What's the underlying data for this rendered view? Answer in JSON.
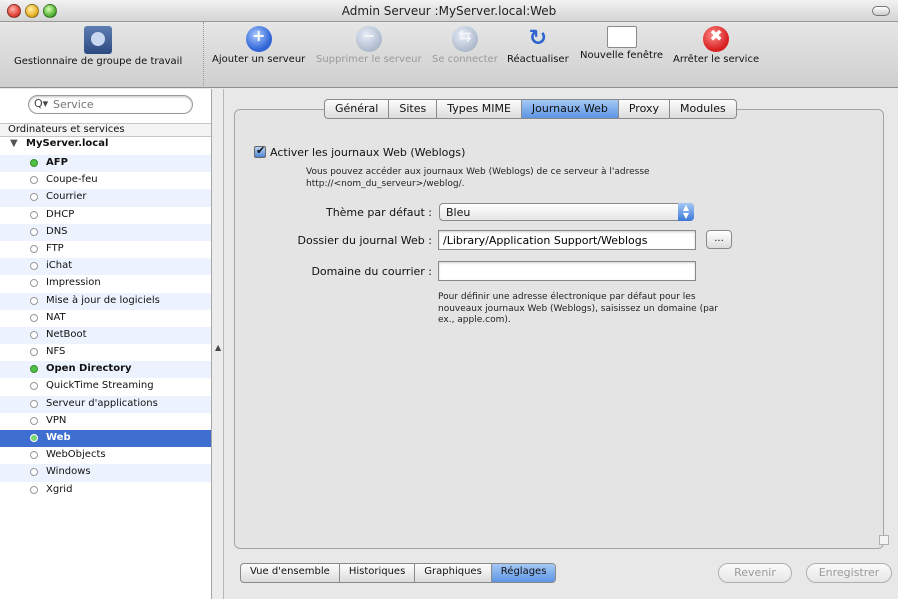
{
  "window": {
    "title": "Admin Serveur :MyServer.local:Web"
  },
  "toolbar": {
    "left_label": "Gestionnaire de groupe de travail",
    "items": [
      {
        "label": "Ajouter un serveur",
        "icon": "add-server-icon",
        "enabled": true
      },
      {
        "label": "Supprimer le serveur",
        "icon": "remove-server-icon",
        "enabled": false
      },
      {
        "label": "Se connecter",
        "icon": "connect-icon",
        "enabled": false
      },
      {
        "label": "Réactualiser",
        "icon": "refresh-icon",
        "enabled": true
      },
      {
        "label": "Nouvelle fenêtre",
        "icon": "new-window-icon",
        "enabled": true
      },
      {
        "label": "Arrêter le service",
        "icon": "stop-service-icon",
        "enabled": true
      }
    ],
    "stop_glyph": "✖",
    "refresh_glyph": "↻"
  },
  "sidebar": {
    "search_placeholder": "Service",
    "search_glyph": "Q▾",
    "header": "Ordinateurs et services",
    "server": "MyServer.local",
    "services": [
      {
        "name": "AFP",
        "running": true,
        "bold": true
      },
      {
        "name": "Coupe-feu",
        "running": false
      },
      {
        "name": "Courrier",
        "running": false
      },
      {
        "name": "DHCP",
        "running": false
      },
      {
        "name": "DNS",
        "running": false
      },
      {
        "name": "FTP",
        "running": false
      },
      {
        "name": "iChat",
        "running": false
      },
      {
        "name": "Impression",
        "running": false
      },
      {
        "name": "Mise à jour de logiciels",
        "running": false
      },
      {
        "name": "NAT",
        "running": false
      },
      {
        "name": "NetBoot",
        "running": false
      },
      {
        "name": "NFS",
        "running": false
      },
      {
        "name": "Open Directory",
        "running": true,
        "bold": true
      },
      {
        "name": "QuickTime Streaming",
        "running": false
      },
      {
        "name": "Serveur d'applications",
        "running": false
      },
      {
        "name": "VPN",
        "running": false
      },
      {
        "name": "Web",
        "running": true,
        "bold": true,
        "selected": true
      },
      {
        "name": "WebObjects",
        "running": false
      },
      {
        "name": "Windows",
        "running": false
      },
      {
        "name": "Xgrid",
        "running": false
      }
    ]
  },
  "tabs": [
    "Général",
    "Sites",
    "Types MIME",
    "Journaux Web",
    "Proxy",
    "Modules"
  ],
  "active_tab": "Journaux Web",
  "weblogs": {
    "enable_label": "Activer les journaux Web (Weblogs)",
    "enabled": true,
    "description": "Vous pouvez accéder aux journaux Web (Weblogs) de ce serveur à l'adresse http://<nom_du_serveur>/weblog/.",
    "theme_label": "Thème par défaut :",
    "theme_value": "Bleu",
    "folder_label": "Dossier du journal Web :",
    "folder_value": "/Library/Application Support/Weblogs",
    "browse_label": "...",
    "mail_label": "Domaine du courrier :",
    "mail_value": "",
    "hint": "Pour définir une adresse électronique par défaut pour les nouveaux journaux Web (Weblogs), saisissez un domaine (par ex., apple.com)."
  },
  "bottom_tabs": [
    "Vue d'ensemble",
    "Historiques",
    "Graphiques",
    "Réglages"
  ],
  "bottom_active": "Réglages",
  "buttons": {
    "revert": "Revenir",
    "save": "Enregistrer"
  }
}
